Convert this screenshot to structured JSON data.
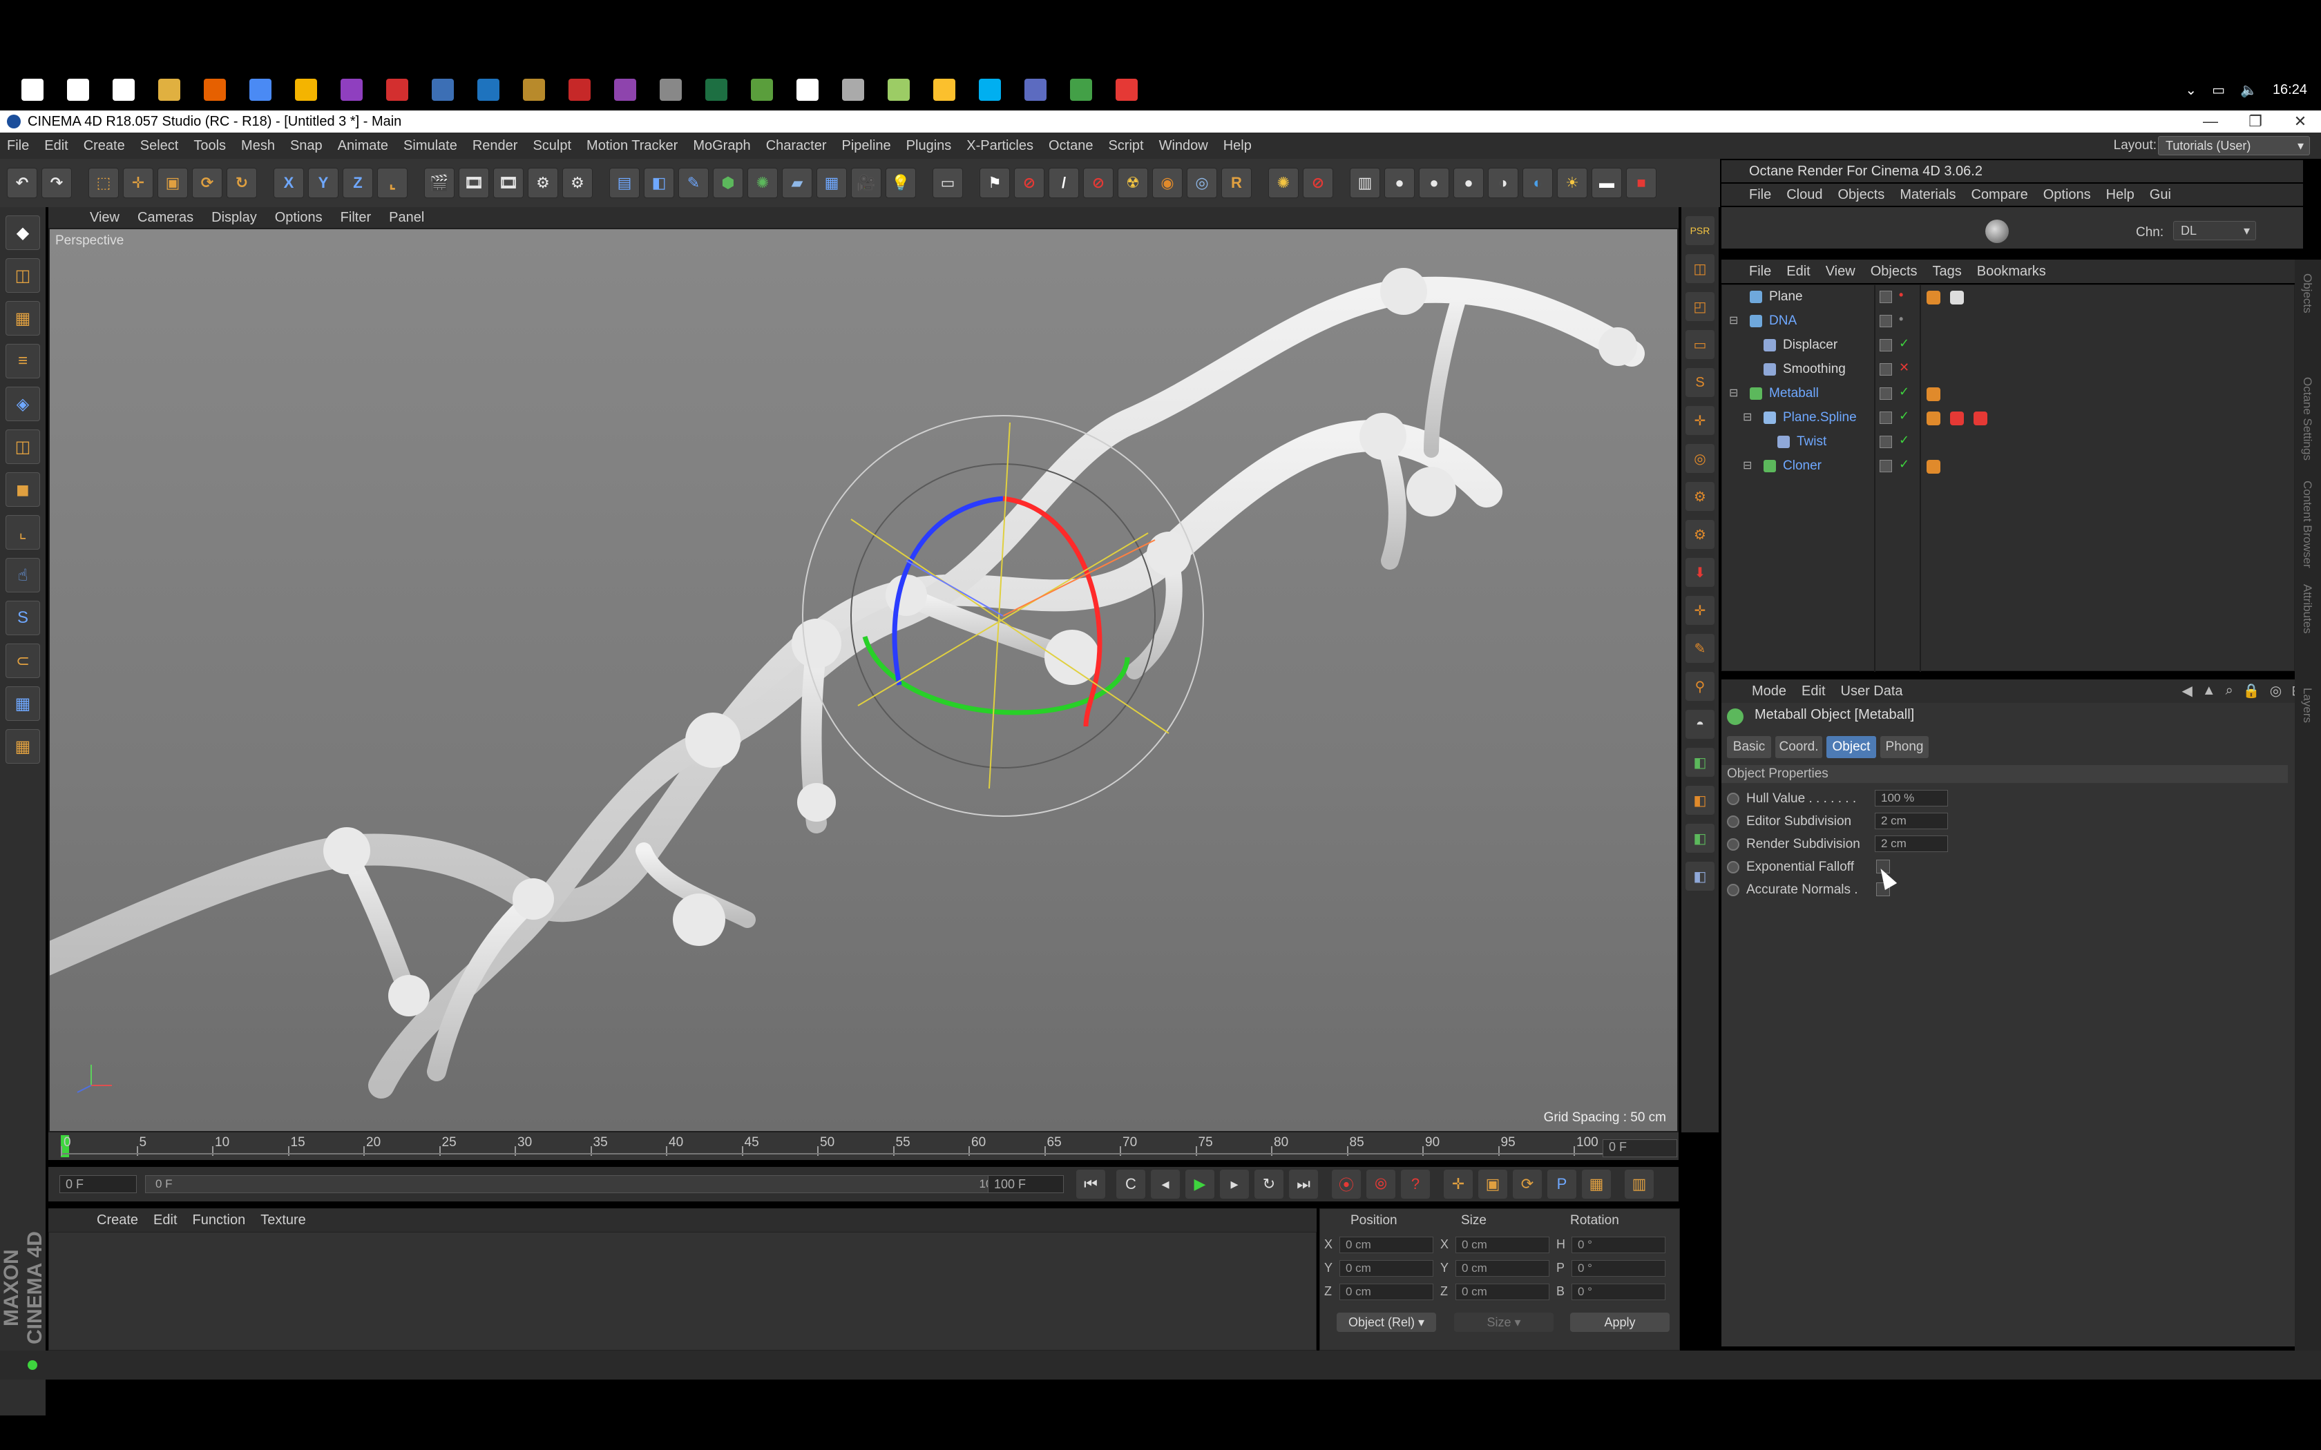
{
  "taskbar": {
    "time": "16:24",
    "apps": [
      {
        "name": "windows-start-icon",
        "color": "#ffffff"
      },
      {
        "name": "search-icon",
        "color": "#ffffff"
      },
      {
        "name": "task-view-icon",
        "color": "#ffffff"
      },
      {
        "name": "file-explorer-icon",
        "color": "#e0b040"
      },
      {
        "name": "firefox-icon",
        "color": "#e66000"
      },
      {
        "name": "chrome-icon",
        "color": "#4a8af4"
      },
      {
        "name": "chrome-canary-icon",
        "color": "#f4b400"
      },
      {
        "name": "onenote-icon",
        "color": "#8f3fbf"
      },
      {
        "name": "acrobat-icon",
        "color": "#d32f2f"
      },
      {
        "name": "cinema4d-icon",
        "color": "#3c6fb5"
      },
      {
        "name": "photoshop-icon",
        "color": "#1e73be"
      },
      {
        "name": "media-encoder-icon",
        "color": "#b88a2b"
      },
      {
        "name": "record-icon",
        "color": "#c62828"
      },
      {
        "name": "affinity-icon",
        "color": "#8e44ad"
      },
      {
        "name": "capture-icon",
        "color": "#888888"
      },
      {
        "name": "excel-icon",
        "color": "#1d6f42"
      },
      {
        "name": "maps-icon",
        "color": "#5a9e3c"
      },
      {
        "name": "skype-s-icon",
        "color": "#ffffff"
      },
      {
        "name": "network-icon",
        "color": "#aaaaaa"
      },
      {
        "name": "leaf-icon",
        "color": "#9ccc65"
      },
      {
        "name": "sticky-notes-icon",
        "color": "#fbc02d"
      },
      {
        "name": "skype-icon",
        "color": "#00aff0"
      },
      {
        "name": "vpn-icon",
        "color": "#5c6bc0"
      },
      {
        "name": "camtasia-icon",
        "color": "#43a047"
      },
      {
        "name": "camtasia-recorder-icon",
        "color": "#e53935"
      }
    ]
  },
  "window": {
    "title": "CINEMA 4D R18.057 Studio (RC - R18) - [Untitled 3 *] - Main",
    "minimize": "—",
    "restore": "❐",
    "close": "✕"
  },
  "menubar": {
    "items": [
      "File",
      "Edit",
      "Create",
      "Select",
      "Tools",
      "Mesh",
      "Snap",
      "Animate",
      "Simulate",
      "Render",
      "Sculpt",
      "Motion Tracker",
      "MoGraph",
      "Character",
      "Pipeline",
      "Plugins",
      "X-Particles",
      "Octane",
      "Script",
      "Window",
      "Help"
    ],
    "layout_label": "Layout:",
    "layout_value": "Tutorials (User)"
  },
  "viewport": {
    "menu": [
      "View",
      "Cameras",
      "Display",
      "Options",
      "Filter",
      "Panel"
    ],
    "label": "Perspective",
    "grid_spacing": "Grid Spacing : 50 cm"
  },
  "timeline": {
    "ticks": [
      "0",
      "5",
      "10",
      "15",
      "20",
      "25",
      "30",
      "35",
      "40",
      "45",
      "50",
      "55",
      "60",
      "65",
      "70",
      "75",
      "80",
      "85",
      "90",
      "95",
      "100"
    ],
    "current_frame": "0 F",
    "start_field": "0 F",
    "range_start": "0 F",
    "range_end": "100 F",
    "end_field": "100 F"
  },
  "material_manager": {
    "menu": [
      "Create",
      "Edit",
      "Function",
      "Texture"
    ]
  },
  "coordinates": {
    "headers": [
      "Position",
      "Size",
      "Rotation"
    ],
    "rows": [
      {
        "ax1": "X",
        "pos": "0 cm",
        "ax2": "X",
        "size": "0 cm",
        "ax3": "H",
        "rot": "0 °"
      },
      {
        "ax1": "Y",
        "pos": "0 cm",
        "ax2": "Y",
        "size": "0 cm",
        "ax3": "P",
        "rot": "0 °"
      },
      {
        "ax1": "Z",
        "pos": "0 cm",
        "ax2": "Z",
        "size": "0 cm",
        "ax3": "B",
        "rot": "0 °"
      }
    ],
    "mode": "Object (Rel)",
    "size_mode": "Size",
    "apply": "Apply"
  },
  "maxon": "MAXON CINEMA 4D",
  "octane": {
    "title": "Octane Render For Cinema 4D 3.06.2",
    "menu": [
      "File",
      "Cloud",
      "Objects",
      "Materials",
      "Compare",
      "Options",
      "Help",
      "Gui"
    ],
    "chn_label": "Chn:",
    "chn_value": "DL"
  },
  "object_manager": {
    "menu": [
      "File",
      "Edit",
      "View",
      "Objects",
      "Tags",
      "Bookmarks"
    ],
    "objects": [
      {
        "name": "Plane",
        "color": "#d8d8d8",
        "icon_color": "#6fa8dc"
      },
      {
        "name": "DNA",
        "color": "#6fa8ff",
        "icon_color": "#6fa8dc"
      },
      {
        "name": "Displacer",
        "color": "#d8d8d8",
        "icon_color": "#8fa8d8"
      },
      {
        "name": "Smoothing",
        "color": "#d8d8d8",
        "icon_color": "#8fa8d8"
      },
      {
        "name": "Metaball",
        "color": "#6fa8ff",
        "icon_color": "#5cb85c"
      },
      {
        "name": "Plane.Spline",
        "color": "#6fa8ff",
        "icon_color": "#8fb8e8"
      },
      {
        "name": "Twist",
        "color": "#6fa8ff",
        "icon_color": "#8fa8d8"
      },
      {
        "name": "Cloner",
        "color": "#6fa8ff",
        "icon_color": "#5cb85c"
      }
    ]
  },
  "attribute_manager": {
    "menu": [
      "Mode",
      "Edit",
      "User Data"
    ],
    "title": "Metaball Object [Metaball]",
    "tabs": [
      "Basic",
      "Coord.",
      "Object",
      "Phong"
    ],
    "active_tab": "Object",
    "section": "Object Properties",
    "props": [
      {
        "label": "Hull Value . . . . . . .",
        "value": "100 %"
      },
      {
        "label": "Editor Subdivision",
        "value": "2 cm"
      },
      {
        "label": "Render Subdivision",
        "value": "2 cm"
      },
      {
        "label": "Exponential Falloff",
        "value": ""
      },
      {
        "label": "Accurate Normals .",
        "value": ""
      }
    ]
  },
  "side_tabs": [
    "Objects",
    "Octane Settings",
    "Content Browser",
    "Attributes",
    "Layers"
  ]
}
